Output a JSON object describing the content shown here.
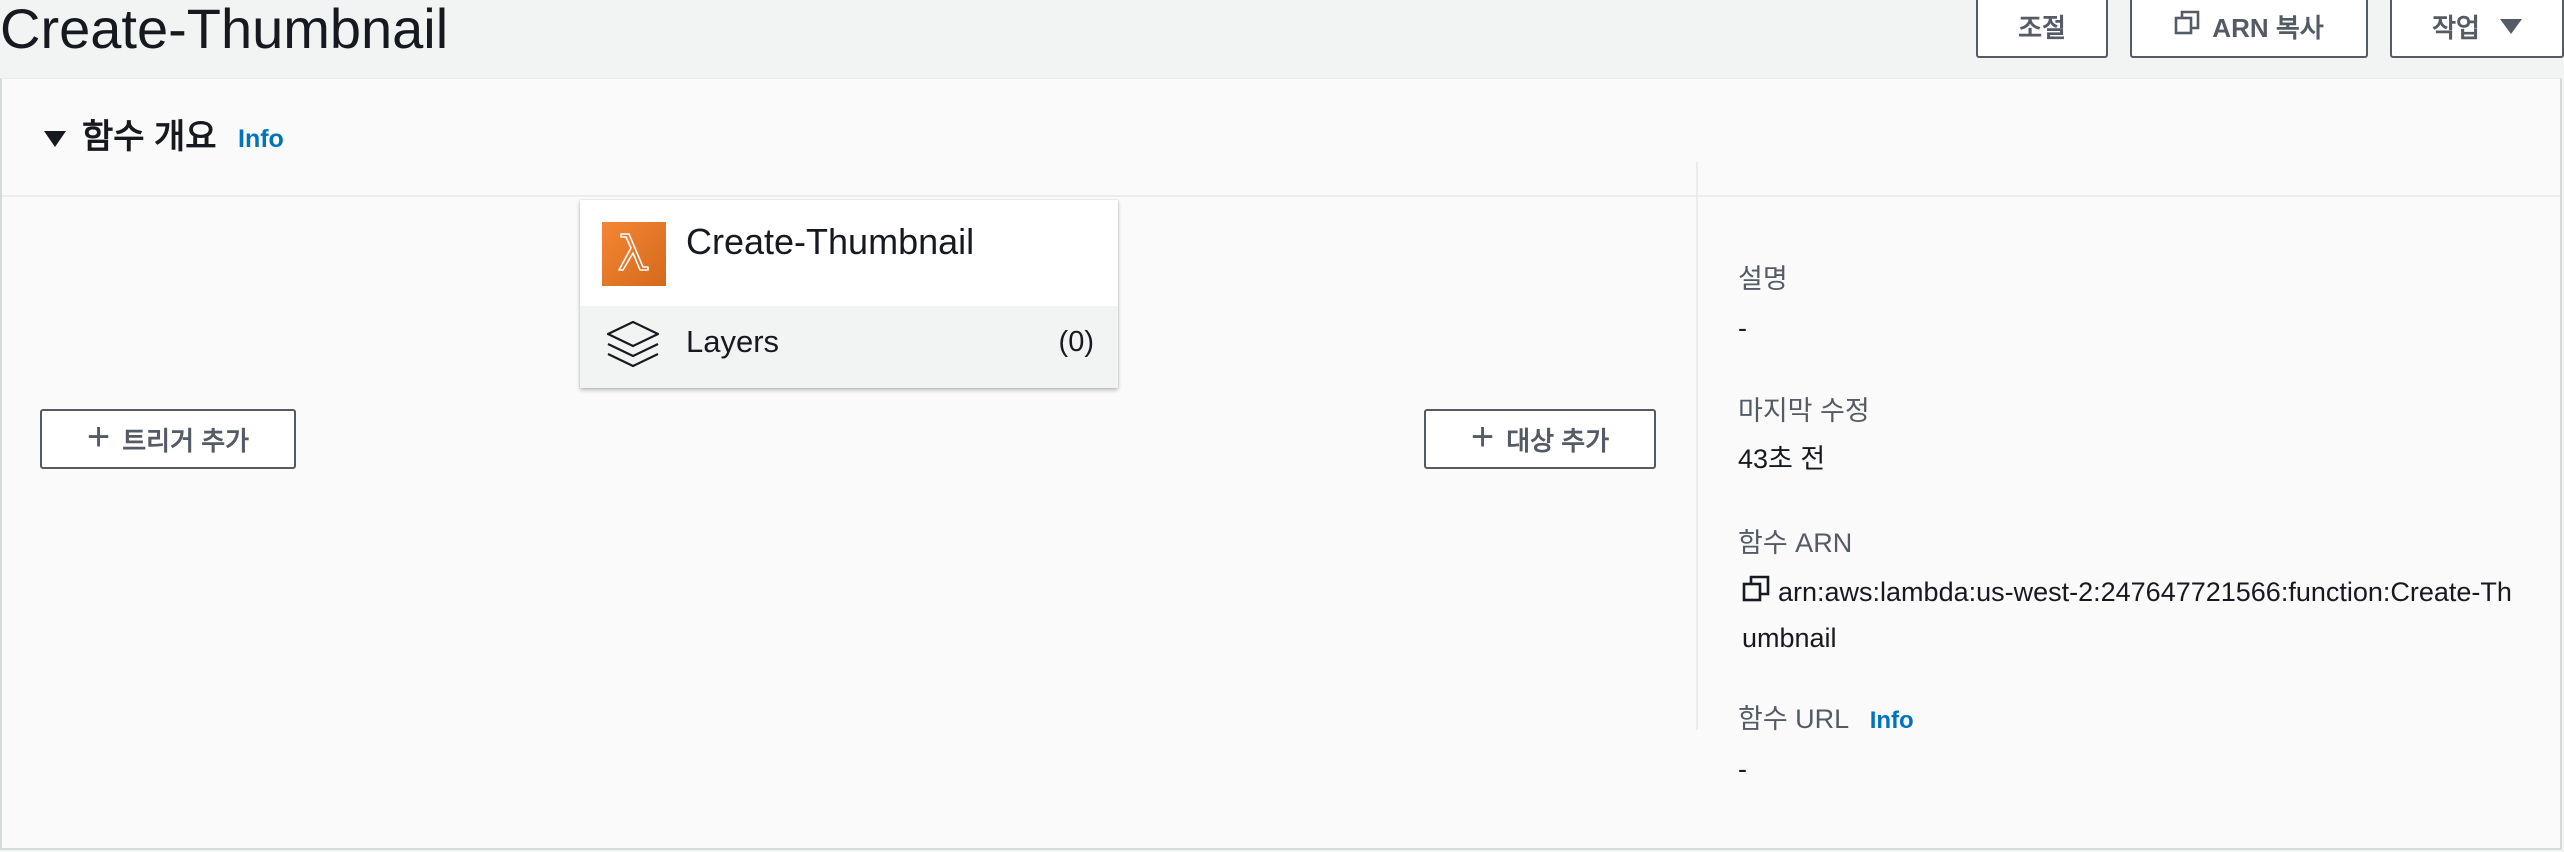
{
  "page": {
    "title": "Create-Thumbnail"
  },
  "toolbar": {
    "throttle_label": "조절",
    "copy_arn_label": "ARN 복사",
    "actions_label": "작업"
  },
  "overview": {
    "section_title": "함수 개요",
    "info_label": "Info",
    "function_card": {
      "name": "Create-Thumbnail",
      "icon": "lambda-icon",
      "icon_color": "#e8781f",
      "layers_label": "Layers",
      "layers_count": "(0)"
    },
    "add_trigger_label": "트리거 추가",
    "add_destination_label": "대상 추가",
    "details": {
      "description_label": "설명",
      "description_value": "-",
      "last_modified_label": "마지막 수정",
      "last_modified_value": "43초 전",
      "arn_label": "함수 ARN",
      "arn_value": "arn:aws:lambda:us-west-2:247647721566:function:Create-Thumbnail",
      "url_label": "함수 URL",
      "url_info_label": "Info",
      "url_value": "-"
    }
  },
  "colors": {
    "link": "#0073bb",
    "button_border": "#545b64",
    "lambda_orange": "#e8781f"
  }
}
